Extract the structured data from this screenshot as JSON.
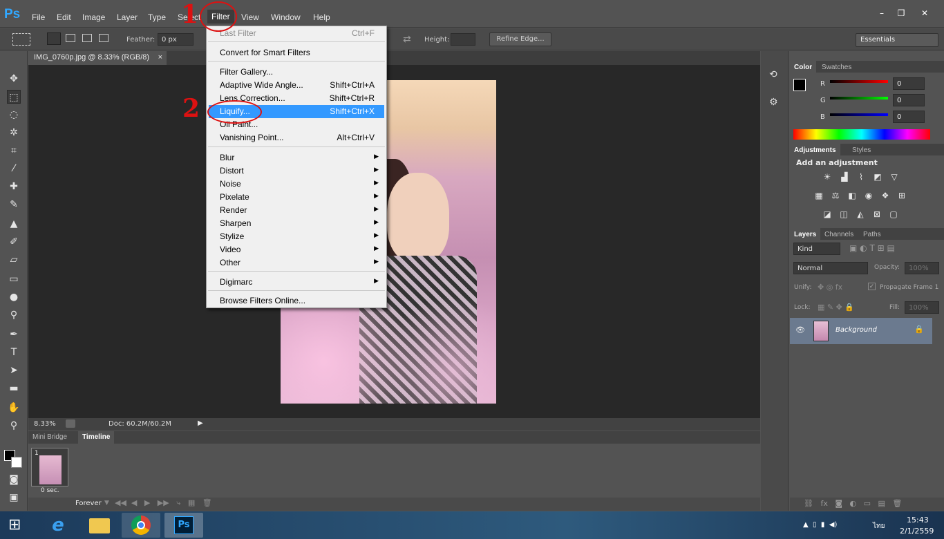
{
  "app": {
    "logo": "Ps",
    "menus": [
      "File",
      "Edit",
      "Image",
      "Layer",
      "Type",
      "Select",
      "Filter",
      "View",
      "Window",
      "Help"
    ],
    "window_controls": [
      "–",
      "❐",
      "✕"
    ]
  },
  "options": {
    "feather_label": "Feather:",
    "feather_value": "0 px",
    "height_label": "Height:",
    "refine_edge": "Refine Edge...",
    "workspace": "Essentials"
  },
  "document": {
    "tab_title": "IMG_0760p.jpg @ 8.33% (RGB/8)",
    "tab_close": "×",
    "zoom": "8.33%",
    "doc_size": "Doc: 60.2M/60.2M"
  },
  "bottom_panel": {
    "tabs": [
      "Mini Bridge",
      "Timeline"
    ],
    "frame_number": "1",
    "frame_delay": "0 sec.",
    "loop": "Forever"
  },
  "color_panel": {
    "tabs": [
      "Color",
      "Swatches"
    ],
    "channels": [
      {
        "label": "R",
        "value": "0",
        "color": "#e02020"
      },
      {
        "label": "G",
        "value": "0",
        "color": "#20c020"
      },
      {
        "label": "B",
        "value": "0",
        "color": "#2030e0"
      }
    ]
  },
  "adjustments_panel": {
    "tabs": [
      "Adjustments",
      "Styles"
    ],
    "heading": "Add an adjustment"
  },
  "layers_panel": {
    "tabs": [
      "Layers",
      "Channels",
      "Paths"
    ],
    "kind": "Kind",
    "blend_mode": "Normal",
    "opacity_label": "Opacity:",
    "opacity_value": "100%",
    "unify_label": "Unify:",
    "propagate": "Propagate Frame 1",
    "lock_label": "Lock:",
    "fill_label": "Fill:",
    "fill_value": "100%",
    "layer_name": "Background"
  },
  "filter_menu": {
    "items": [
      {
        "label": "Last Filter",
        "shortcut": "Ctrl+F",
        "disabled": true
      },
      {
        "label": "Convert for Smart Filters",
        "shortcut": ""
      },
      {
        "label": "Filter Gallery...",
        "shortcut": ""
      },
      {
        "label": "Adaptive Wide Angle...",
        "shortcut": "Shift+Ctrl+A"
      },
      {
        "label": "Lens Correction...",
        "shortcut": "Shift+Ctrl+R"
      },
      {
        "label": "Liquify...",
        "shortcut": "Shift+Ctrl+X",
        "highlighted": true
      },
      {
        "label": "Oil Paint...",
        "shortcut": ""
      },
      {
        "label": "Vanishing Point...",
        "shortcut": "Alt+Ctrl+V"
      },
      {
        "label": "Blur",
        "submenu": true
      },
      {
        "label": "Distort",
        "submenu": true
      },
      {
        "label": "Noise",
        "submenu": true
      },
      {
        "label": "Pixelate",
        "submenu": true
      },
      {
        "label": "Render",
        "submenu": true
      },
      {
        "label": "Sharpen",
        "submenu": true
      },
      {
        "label": "Stylize",
        "submenu": true
      },
      {
        "label": "Video",
        "submenu": true
      },
      {
        "label": "Other",
        "submenu": true
      },
      {
        "label": "Digimarc",
        "submenu": true
      },
      {
        "label": "Browse Filters Online...",
        "shortcut": ""
      }
    ]
  },
  "annotations": {
    "step1": "1",
    "step2": "2"
  },
  "taskbar": {
    "time": "15:43",
    "date": "2/1/2559",
    "lang": "ไทย"
  }
}
